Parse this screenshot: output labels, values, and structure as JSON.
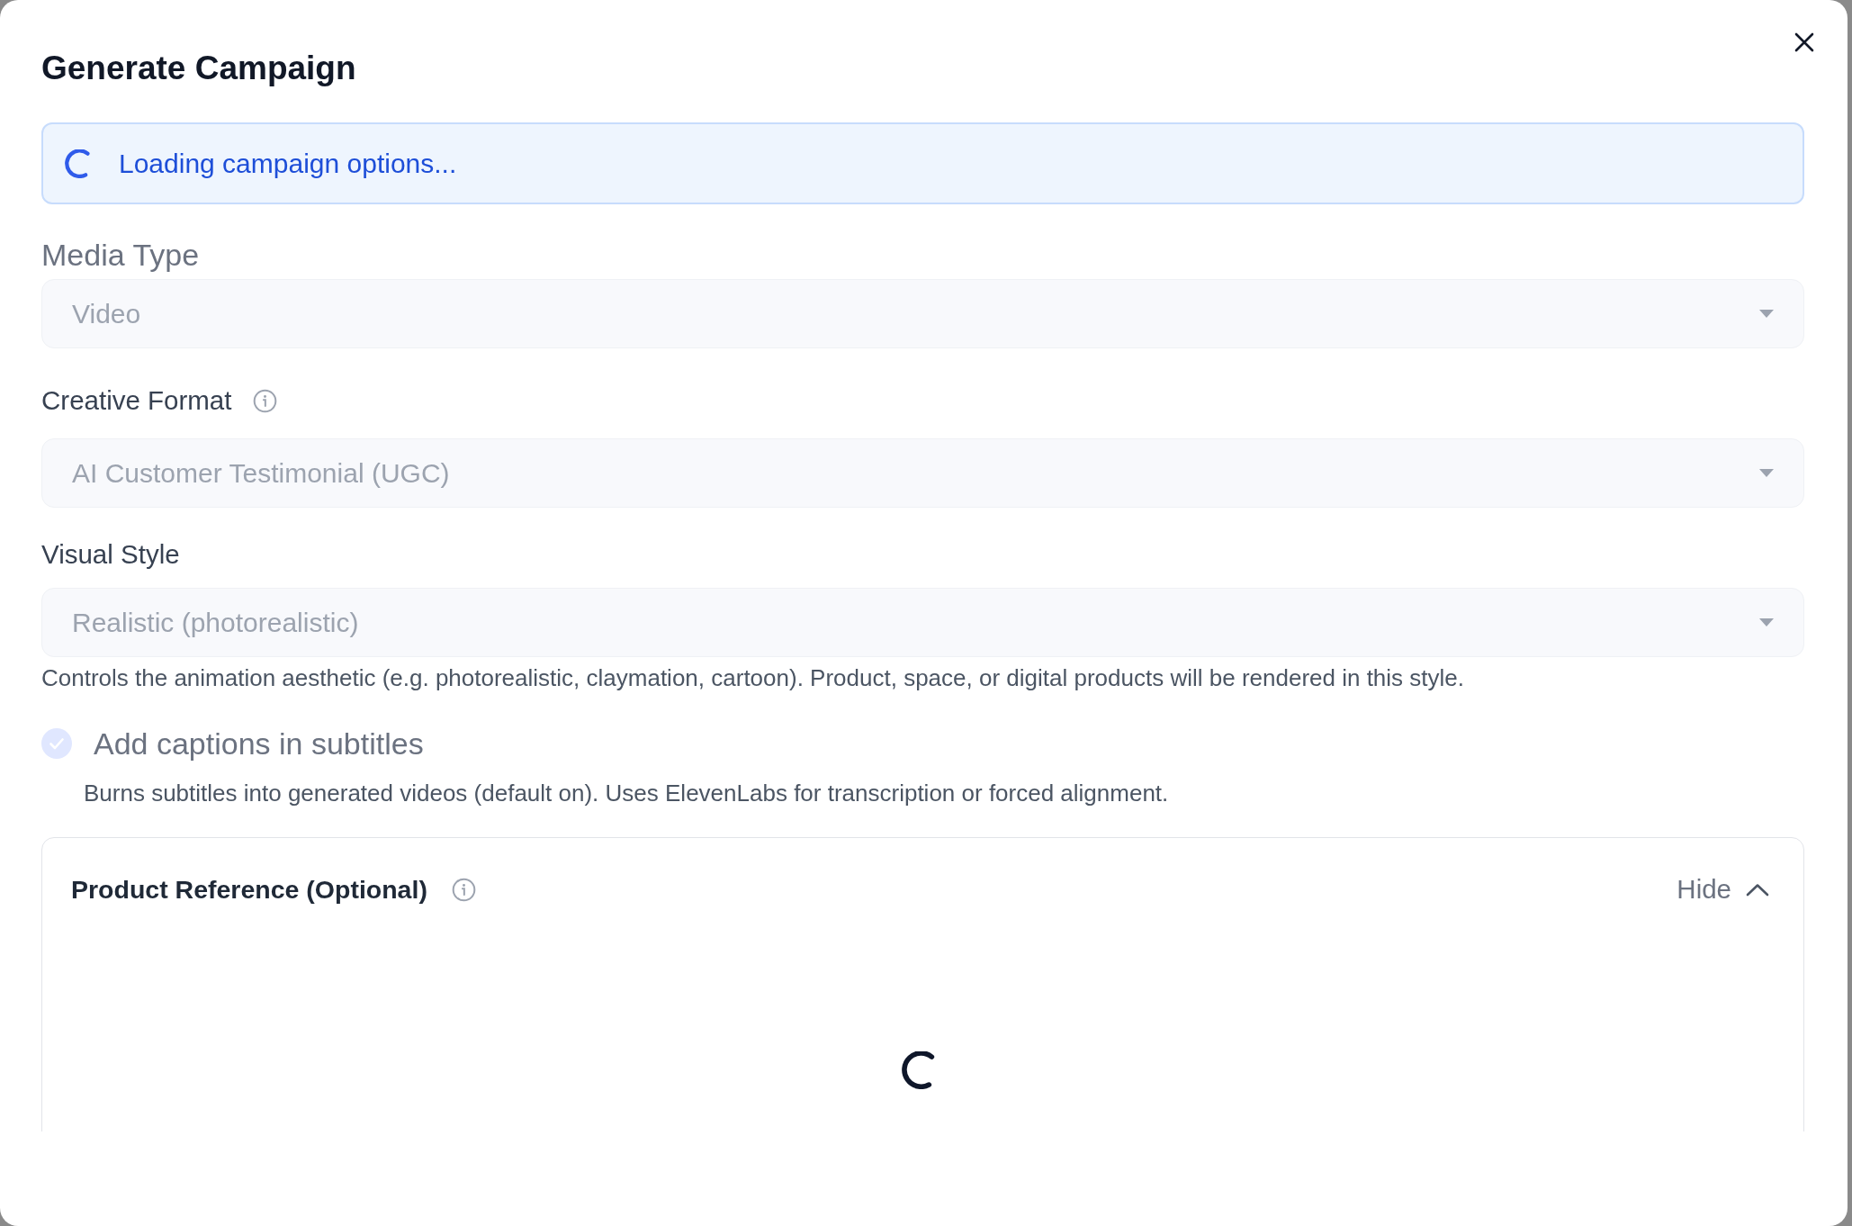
{
  "dialog": {
    "title": "Generate Campaign"
  },
  "loading_banner": {
    "text": "Loading campaign options...",
    "loading": true
  },
  "fields": [
    {
      "label": "Media Type",
      "label_muted": true,
      "info_icon": false,
      "value": "Video",
      "disabled": true
    },
    {
      "label": "Creative Format",
      "label_muted": false,
      "info_icon": true,
      "value": "AI Customer Testimonial (UGC)",
      "disabled": true
    },
    {
      "label": "Visual Style",
      "label_muted": false,
      "info_icon": false,
      "value": "Realistic (photorealistic)",
      "disabled": true,
      "help": "Controls the animation aesthetic (e.g. photorealistic, claymation, cartoon). Product, space, or digital products will be rendered in this style."
    }
  ],
  "captions_option": {
    "label": "Add captions in subtitles",
    "checked": true,
    "disabled": true,
    "description": "Burns subtitles into generated videos (default on). Uses ElevenLabs for transcription or forced alignment."
  },
  "product_reference": {
    "title": "Product Reference (Optional)",
    "info_icon": true,
    "toggle_label": "Hide",
    "expanded": true,
    "loading": true
  }
}
